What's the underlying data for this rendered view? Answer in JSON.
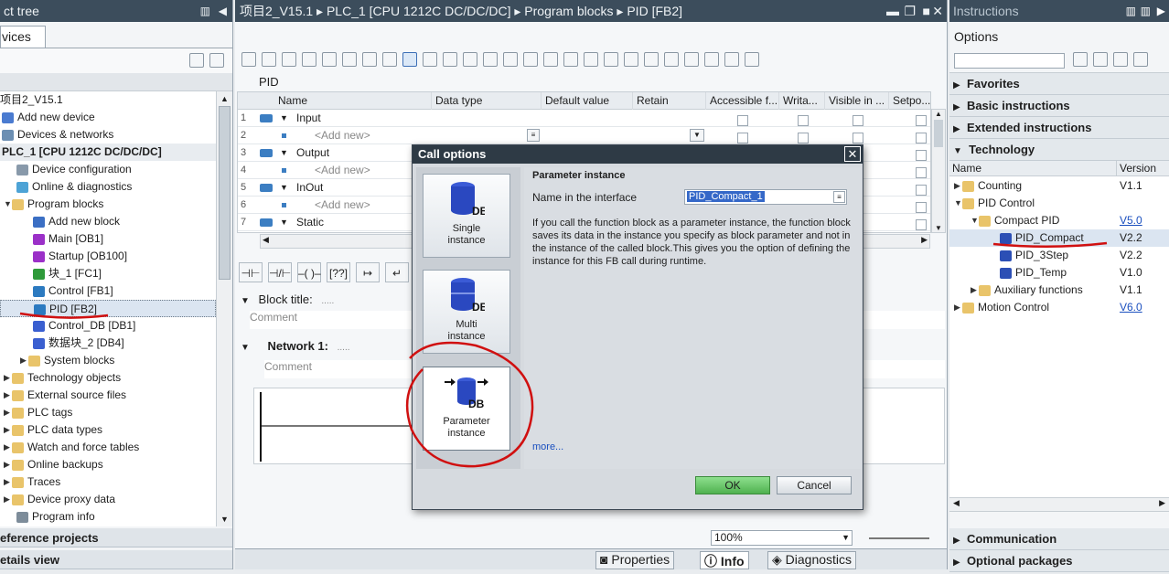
{
  "left_panel": {
    "title": "ct tree",
    "tab": "vices",
    "project": "项目2_V15.1",
    "items": [
      {
        "label": "Add new device",
        "indent": 1
      },
      {
        "label": "Devices & networks",
        "indent": 1
      },
      {
        "label": "PLC_1 [CPU 1212C DC/DC/DC]",
        "indent": 0
      },
      {
        "label": "Device configuration",
        "indent": 2
      },
      {
        "label": "Online & diagnostics",
        "indent": 2
      },
      {
        "label": "Program blocks",
        "indent": 1
      },
      {
        "label": "Add new block",
        "indent": 3
      },
      {
        "label": "Main [OB1]",
        "indent": 3
      },
      {
        "label": "Startup [OB100]",
        "indent": 3
      },
      {
        "label": "块_1 [FC1]",
        "indent": 3
      },
      {
        "label": "Control [FB1]",
        "indent": 3
      },
      {
        "label": "PID [FB2]",
        "indent": 3
      },
      {
        "label": "Control_DB [DB1]",
        "indent": 3
      },
      {
        "label": "数据块_2 [DB4]",
        "indent": 3
      },
      {
        "label": "System blocks",
        "indent": 2
      },
      {
        "label": "Technology objects",
        "indent": 1
      },
      {
        "label": "External source files",
        "indent": 1
      },
      {
        "label": "PLC tags",
        "indent": 1
      },
      {
        "label": "PLC data types",
        "indent": 1
      },
      {
        "label": "Watch and force tables",
        "indent": 1
      },
      {
        "label": "Online backups",
        "indent": 1
      },
      {
        "label": "Traces",
        "indent": 1
      },
      {
        "label": "Device proxy data",
        "indent": 1
      },
      {
        "label": "Program info",
        "indent": 1
      }
    ],
    "reference_projects": "eference projects",
    "details_view": "etails view"
  },
  "editor": {
    "title": "项目2_V15.1 ▸ PLC_1 [CPU 1212C DC/DC/DC] ▸ Program blocks ▸ PID [FB2]",
    "block_name": "PID",
    "columns": [
      "Name",
      "Data type",
      "Default value",
      "Retain",
      "Accessible f...",
      "Writa...",
      "Visible in ...",
      "Setpo..."
    ],
    "rows": [
      {
        "num": "1",
        "name": "Input",
        "section": true
      },
      {
        "num": "2",
        "name": "<Add new>",
        "section": false
      },
      {
        "num": "3",
        "name": "Output",
        "section": true
      },
      {
        "num": "4",
        "name": "<Add new>",
        "section": false
      },
      {
        "num": "5",
        "name": "InOut",
        "section": true
      },
      {
        "num": "6",
        "name": "<Add new>",
        "section": false
      },
      {
        "num": "7",
        "name": "Static",
        "section": true
      }
    ],
    "block_title": "Block title:",
    "block_title_dots": ".....",
    "comment_label": "Comment",
    "network_label": "Network 1:",
    "network_dots": ".....",
    "zoom": "100%"
  },
  "dialog": {
    "title": "Call options",
    "options": [
      {
        "label": "Single\ninstance"
      },
      {
        "label": "Multi\ninstance"
      },
      {
        "label": "Parameter\ninstance"
      }
    ],
    "heading": "Parameter instance",
    "name_label": "Name in the interface",
    "name_value": "PID_Compact_1",
    "description": "If you call the function block as a parameter instance, the function block saves its data in the instance you specify as block parameter and not in the instance of the called block.This gives you the option of defining the instance for this FB call during runtime.",
    "more": "more...",
    "ok": "OK",
    "cancel": "Cancel",
    "db": "DB"
  },
  "right_panel": {
    "title": "Instructions",
    "options_label": "Options",
    "sections": [
      "Favorites",
      "Basic instructions",
      "Extended instructions",
      "Technology"
    ],
    "col_name": "Name",
    "col_version": "Version",
    "items": [
      {
        "label": "Counting",
        "version": "V1.1",
        "indent": 0
      },
      {
        "label": "PID Control",
        "version": "",
        "indent": 0
      },
      {
        "label": "Compact PID",
        "version": "V5.0",
        "indent": 1
      },
      {
        "label": "PID_Compact",
        "version": "V2.2",
        "indent": 2
      },
      {
        "label": "PID_3Step",
        "version": "V2.2",
        "indent": 2
      },
      {
        "label": "PID_Temp",
        "version": "V1.0",
        "indent": 2
      },
      {
        "label": "Auxiliary functions",
        "version": "V1.1",
        "indent": 1
      },
      {
        "label": "Motion Control",
        "version": "V6.0",
        "indent": 0
      }
    ],
    "bottom_sections": [
      "Communication",
      "Optional packages"
    ]
  },
  "statusbar": {
    "properties": "Properties",
    "info": "Info",
    "diagnostics": "Diagnostics"
  },
  "colors": {
    "header": "#3c4d5c",
    "dialog_title": "#2e3a45",
    "ok_button": "#5cb85c",
    "annotation_red": "#d01010"
  }
}
